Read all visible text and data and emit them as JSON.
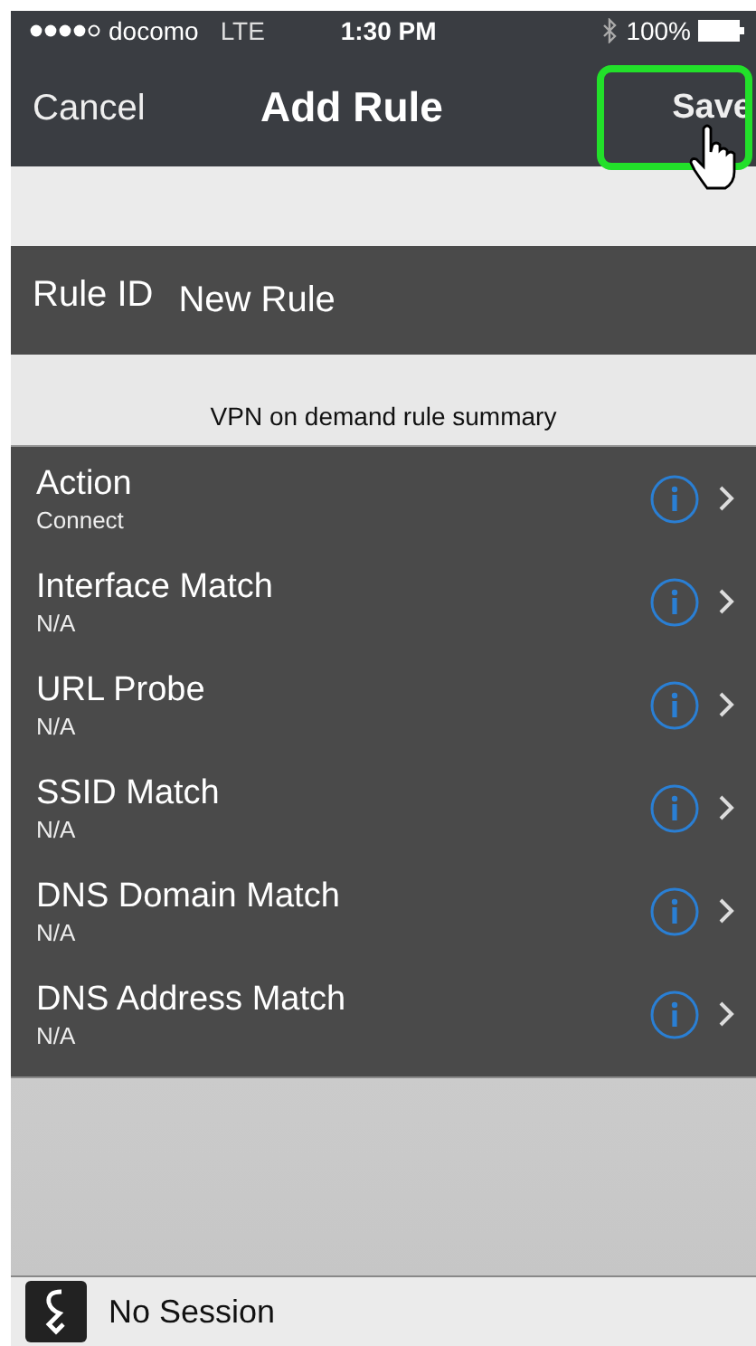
{
  "status_bar": {
    "carrier": "docomo",
    "network": "LTE",
    "time": "1:30 PM",
    "battery": "100%"
  },
  "nav": {
    "left": "Cancel",
    "title": "Add Rule",
    "right": "Save",
    "right_highlighted": true
  },
  "rule_id": {
    "label": "Rule ID",
    "value": "New Rule"
  },
  "section_header": "VPN on demand rule summary",
  "rows": [
    {
      "title": "Action",
      "detail": "Connect"
    },
    {
      "title": "Interface Match",
      "detail": "N/A"
    },
    {
      "title": "URL Probe",
      "detail": "N/A"
    },
    {
      "title": "SSID Match",
      "detail": "N/A"
    },
    {
      "title": "DNS Domain Match",
      "detail": "N/A"
    },
    {
      "title": "DNS Address Match",
      "detail": "N/A"
    }
  ],
  "footer": {
    "status": "No Session"
  }
}
